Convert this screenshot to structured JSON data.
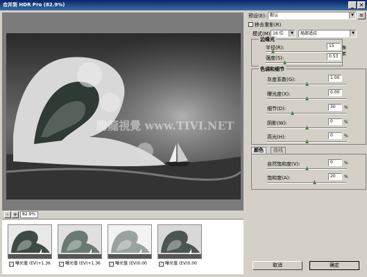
{
  "window": {
    "title": "合并到 HDR Pro (82.9%)",
    "min": "_",
    "close": "✕"
  },
  "preview": {
    "watermark": "腾龍視覺 www.TIVI.NET"
  },
  "zoom": {
    "value": "82.9%",
    "minus": "-",
    "plus": "+"
  },
  "thumbnails": [
    {
      "label": "曝光值 (EV)+1.36",
      "checked": true
    },
    {
      "label": "曝光值 (EV)+1.36",
      "checked": true
    },
    {
      "label": "曝光值 (EV)0.00",
      "checked": true
    },
    {
      "label": "曝光值 (EV)0.00",
      "checked": true
    }
  ],
  "panel": {
    "preset_label": "预设(E):",
    "preset_value": "默认",
    "remove_ghosts": "移去重影(R)",
    "mode_label": "模式(M):",
    "mode_bits": "16 位",
    "mode_method": "局部适应",
    "edge_glow": {
      "heading": "边缘光",
      "radius_label": "半径(R):",
      "radius_value": "15",
      "radius_unit": "像素",
      "strength_label": "强度(S):",
      "strength_value": "0.53"
    },
    "tone": {
      "heading": "色调和细节",
      "gamma_label": "灰度系数(G):",
      "gamma_value": "1.00",
      "exposure_label": "曝光度(X):",
      "exposure_value": "0.00",
      "detail_label": "细节(D):",
      "detail_value": "30",
      "detail_unit": "%",
      "shadow_label": "阴影(W):",
      "shadow_value": "0",
      "shadow_unit": "%",
      "highlight_label": "高光(H):",
      "highlight_value": "0",
      "highlight_unit": "%"
    },
    "tabs": {
      "color": "颜色",
      "curve": "曲线"
    },
    "color": {
      "vibrance_label": "自然饱和度(V):",
      "vibrance_value": "0",
      "vibrance_unit": "%",
      "saturation_label": "饱和度(A):",
      "saturation_value": "20",
      "saturation_unit": "%"
    },
    "cancel": "取消",
    "ok": "确定"
  },
  "icons": {
    "dropdown": "▼",
    "menu": "≡",
    "check": "✓"
  }
}
